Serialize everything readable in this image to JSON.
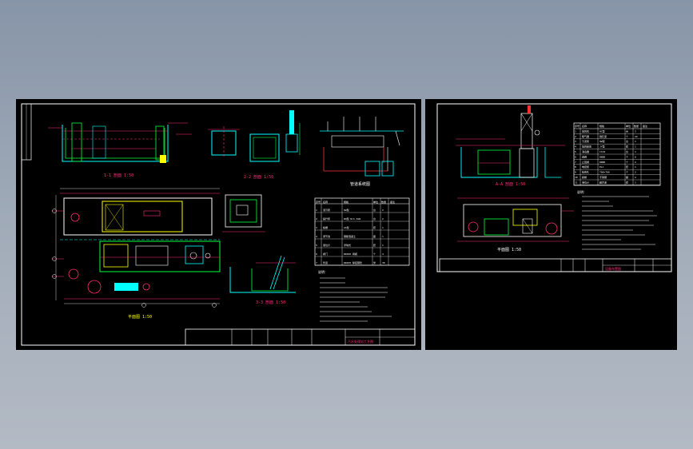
{
  "sheets": {
    "left": {
      "views": {
        "section_top_left": "1-1 剖面 1:50",
        "section_top_mid": "2-2 剖面 1:50",
        "plan_main": "平面图 1:50",
        "detail_right": "3-3 剖面 1:50",
        "pipe_schematic": "管道系统图"
      },
      "table_header": [
        "序号",
        "名称",
        "规格",
        "单位",
        "数量",
        "备注"
      ],
      "table_rows": [
        [
          "1",
          "潜污泵",
          "QW型",
          "台",
          "2"
        ],
        [
          "2",
          "提升泵",
          "WQ型 N=1.5kW",
          "台",
          "2"
        ],
        [
          "3",
          "格栅",
          "GS型",
          "套",
          "1"
        ],
        [
          "4",
          "调节池",
          "钢筋混凝土",
          "座",
          "1"
        ],
        [
          "5",
          "液位计",
          "浮球式",
          "套",
          "1"
        ],
        [
          "6",
          "阀门",
          "DN100 闸阀",
          "个",
          "4"
        ],
        [
          "7",
          "管道",
          "DN100 焊接钢管",
          "米",
          "30"
        ]
      ],
      "notes_title": "说明：",
      "title_block": "污水处理站工艺图"
    },
    "right": {
      "views": {
        "section_top": "A-A 剖面 1:50",
        "plan_bottom": "平面图 1:50"
      },
      "table_header": [
        "序号",
        "名称",
        "规格",
        "单位",
        "数量",
        "备注"
      ],
      "table_rows": [
        [
          "1",
          "鼓风机",
          "HC型",
          "台",
          "2"
        ],
        [
          "2",
          "曝气器",
          "微孔型",
          "个",
          "24"
        ],
        [
          "3",
          "污泥泵",
          "QW型",
          "台",
          "1"
        ],
        [
          "4",
          "加药装置",
          "JY型",
          "套",
          "1"
        ],
        [
          "5",
          "消毒器",
          "ClO2",
          "台",
          "1"
        ],
        [
          "6",
          "闸阀",
          "DN80",
          "个",
          "6"
        ],
        [
          "7",
          "止回阀",
          "DN80",
          "个",
          "2"
        ],
        [
          "8",
          "电控柜",
          "PLC",
          "套",
          "1"
        ],
        [
          "9",
          "检修孔",
          "700×700",
          "个",
          "2"
        ],
        [
          "10",
          "爬梯",
          "不锈钢",
          "副",
          "2"
        ],
        [
          "11",
          "液位计",
          "超声波",
          "套",
          "1"
        ]
      ],
      "notes_title": "说明：",
      "title_block": "设备布置图"
    }
  },
  "colors": {
    "background": "#000000",
    "frame": "#ffffff",
    "dimension": "#ff2d7a",
    "structure": "#00ffff",
    "hatch": "#00ff3c",
    "fill_yellow": "#ffff00",
    "pipe_red": "#ff3030",
    "text_white": "#ffffff"
  }
}
